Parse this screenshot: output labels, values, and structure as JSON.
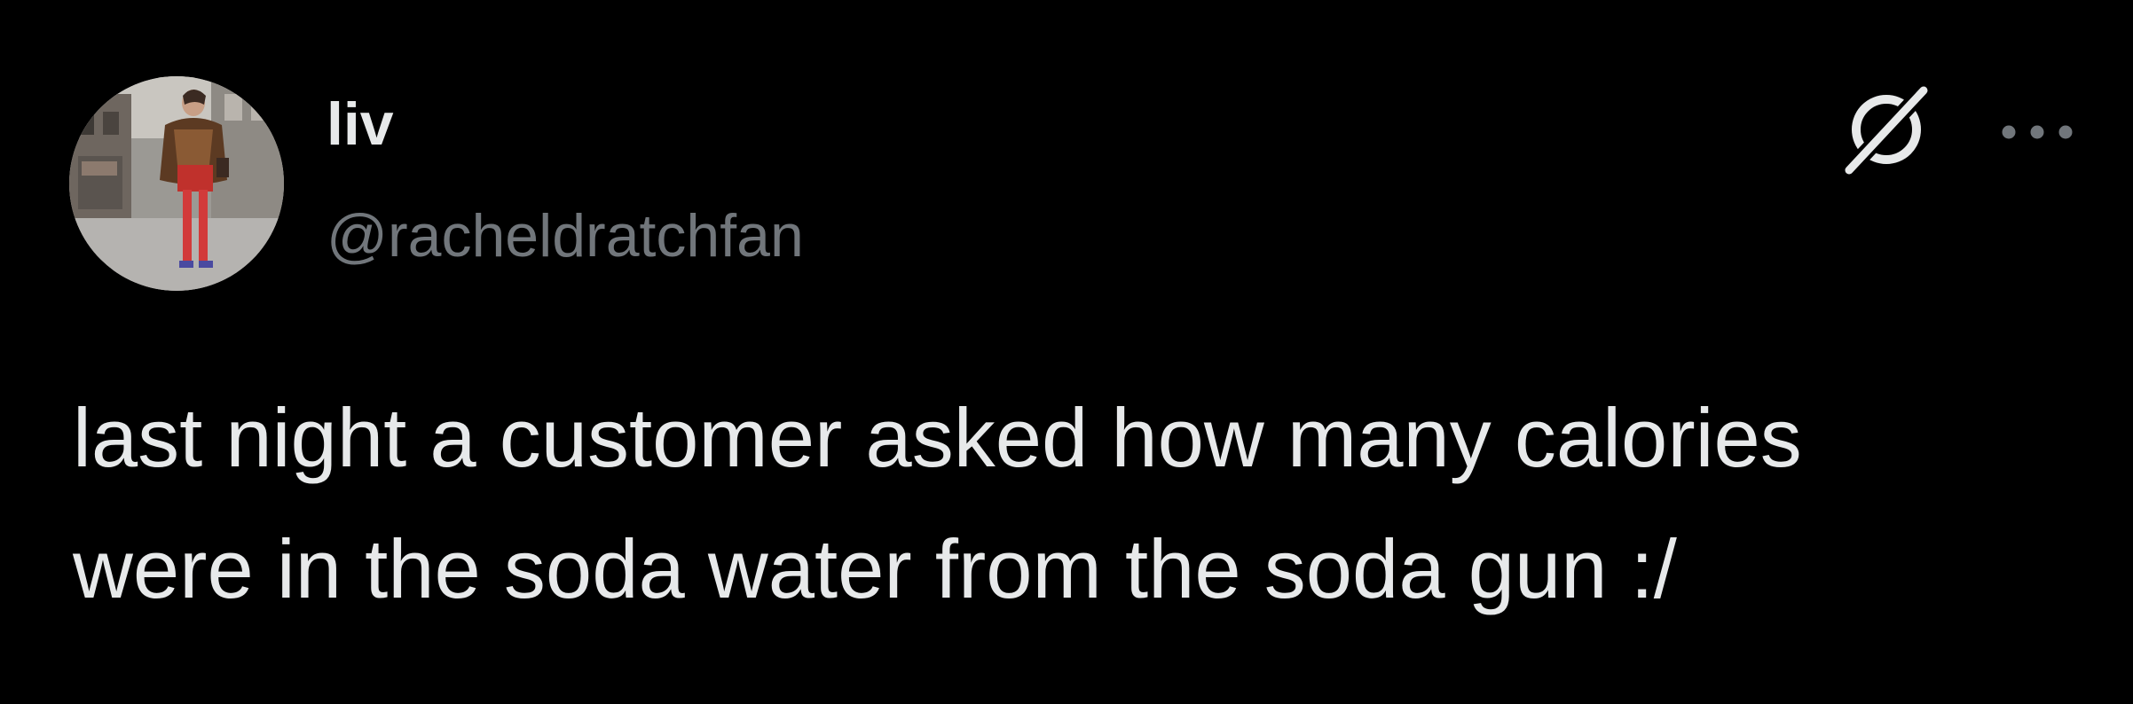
{
  "author": {
    "display_name": "liv",
    "handle": "@racheldratchfan"
  },
  "actions": {
    "grok_icon": "grok-icon",
    "more_icon": "more-dots-icon"
  },
  "tweet": {
    "lines": [
      "last night a customer asked how many calories",
      "were in the soda water from the soda gun :/"
    ]
  },
  "colors": {
    "background": "#000000",
    "primary_text": "#e7e9ea",
    "secondary_text": "#71767b"
  }
}
